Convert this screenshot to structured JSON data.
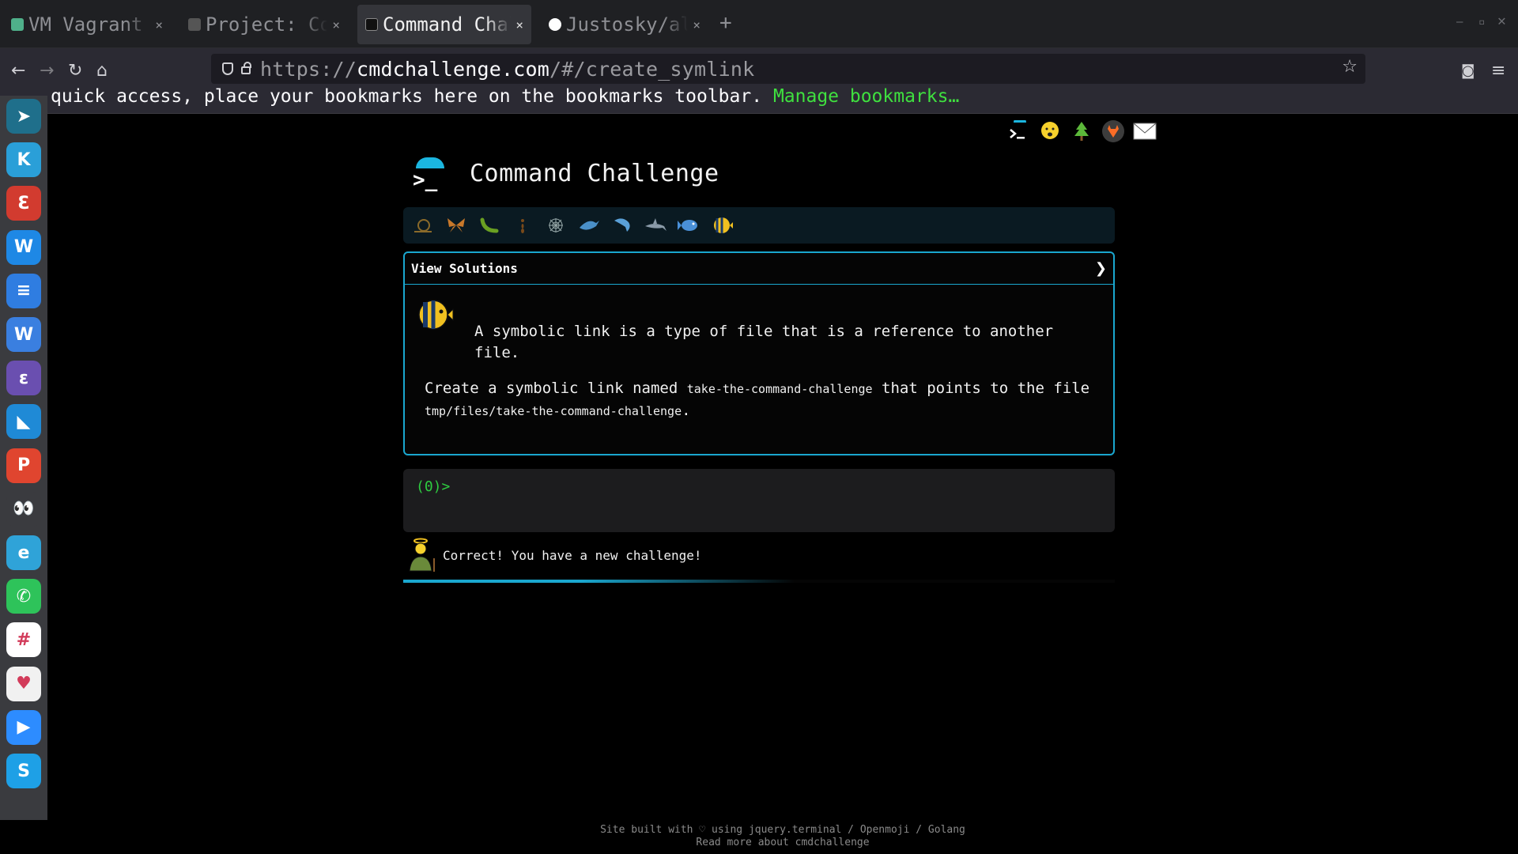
{
  "tabs": [
    {
      "title": "VM Vagrant G",
      "favicon_color": "#4fb08a",
      "active": false
    },
    {
      "title": "Project: Com",
      "favicon_color": "#555555",
      "active": false
    },
    {
      "title": "Command Chal",
      "favicon_color": "#1e1e1e",
      "active": true
    },
    {
      "title": "Justosky/alx",
      "favicon_color": "#ffffff",
      "active": false
    }
  ],
  "tab_close_glyph": "×",
  "new_tab_glyph": "+",
  "url": {
    "scheme": "https://",
    "host": "cmdchallenge.com",
    "path": "/#/create_symlink"
  },
  "bookmarks_bar": {
    "message": "quick access, place your bookmarks here on the bookmarks toolbar.",
    "manage_link": "Manage bookmarks…"
  },
  "dock_apps": [
    {
      "name": "app-1",
      "color": "#1f6f8b",
      "glyph": "➤"
    },
    {
      "name": "kodi",
      "color": "#2a9fd8",
      "glyph": "K"
    },
    {
      "name": "app-3",
      "color": "#d23b2f",
      "glyph": "Ɛ"
    },
    {
      "name": "app-4",
      "color": "#1e88e5",
      "glyph": "W"
    },
    {
      "name": "docs",
      "color": "#2f7de1",
      "glyph": "≡"
    },
    {
      "name": "wps",
      "color": "#3a7fe0",
      "glyph": "W"
    },
    {
      "name": "emacs",
      "color": "#6a4fb0",
      "glyph": "ε"
    },
    {
      "name": "vscode",
      "color": "#1f8ad6",
      "glyph": "◣"
    },
    {
      "name": "wps-presentation",
      "color": "#e0452f",
      "glyph": "P"
    },
    {
      "name": "app-10",
      "color": "#3a3b3f",
      "glyph": "👀"
    },
    {
      "name": "edge",
      "color": "#2fa3d8",
      "glyph": "e"
    },
    {
      "name": "whatsapp",
      "color": "#2ec35a",
      "glyph": "✆"
    },
    {
      "name": "slack",
      "color": "#ffffff",
      "glyph": "#"
    },
    {
      "name": "app-14",
      "color": "#f1f1f1",
      "glyph": "♥"
    },
    {
      "name": "zoom",
      "color": "#2d8cff",
      "glyph": "▶"
    },
    {
      "name": "skype",
      "color": "#1ea0e6",
      "glyph": "S"
    }
  ],
  "page": {
    "title": "Command Challenge",
    "top_icons": [
      "terminal-icon",
      "face-icon",
      "tree-icon",
      "gitlab-icon",
      "mail-icon"
    ],
    "badges": [
      "snail",
      "butterfly",
      "caterpillar",
      "ant",
      "spider-web",
      "whale",
      "dolphin",
      "shark",
      "fish",
      "tropical-fish"
    ],
    "view_solutions_label": "View Solutions",
    "panel_arrow": "❯",
    "intro": "A symbolic link is a type of file that is a reference to another file.",
    "task_prefix": "Create a symbolic link named",
    "link_name": "take-the-command-challenge",
    "task_middle": "that points to the file",
    "target_path": "tmp/files/take-the-command-challenge",
    "task_suffix": ".",
    "prompt": "(0)>",
    "status_message": "Correct! You have a new challenge!",
    "progress_fraction": 0.55,
    "footer_line1": "Site built with ♡ using jquery.terminal / Openmoji / Golang",
    "footer_line2": "Read more about cmdchallenge"
  }
}
